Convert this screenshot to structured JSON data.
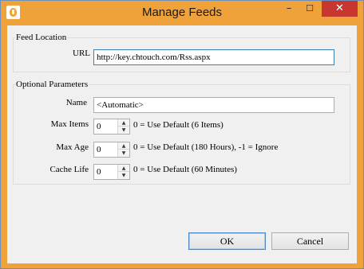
{
  "window": {
    "title": "Manage Feeds",
    "icon": "app-icon",
    "controls": {
      "minimize": "–",
      "maximize": "☐",
      "close": "✕"
    },
    "accent": "#f0a23a",
    "close_color": "#c7372f"
  },
  "feed_location": {
    "legend": "Feed Location",
    "url_label": "URL",
    "url_value": "http://key.chtouch.com/Rss.aspx"
  },
  "optional_parameters": {
    "legend": "Optional Parameters",
    "name_label": "Name",
    "name_value": "<Automatic>",
    "max_items": {
      "label": "Max Items",
      "value": "0",
      "hint": "0 = Use Default (6 Items)"
    },
    "max_age": {
      "label": "Max Age",
      "value": "0",
      "hint": "0 = Use Default (180 Hours), -1 = Ignore"
    },
    "cache_life": {
      "label": "Cache Life",
      "value": "0",
      "hint": "0 = Use Default (60 Minutes)"
    }
  },
  "buttons": {
    "ok": "OK",
    "cancel": "Cancel"
  }
}
